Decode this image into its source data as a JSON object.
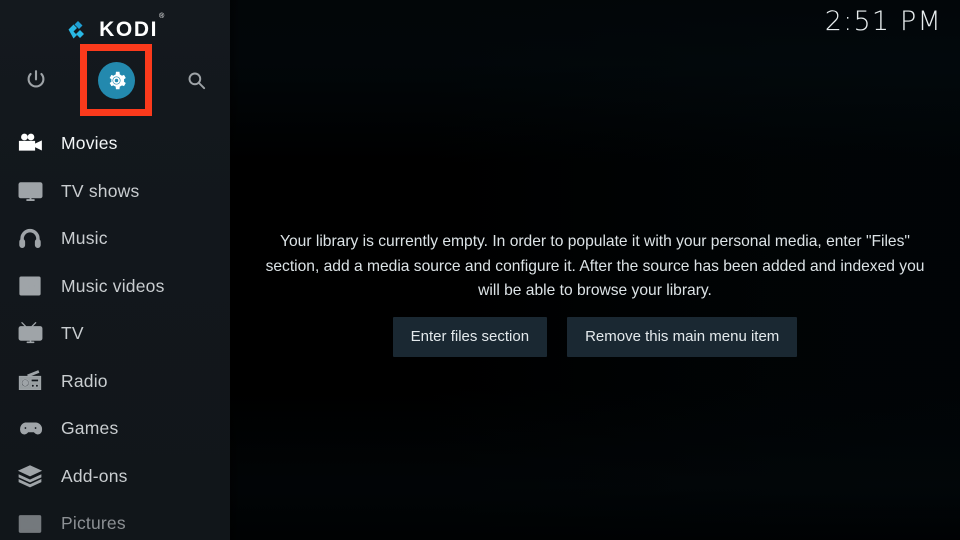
{
  "app": {
    "name": "Kodi",
    "logo_wordmark": "KODI",
    "logo_trademark": "®"
  },
  "colors": {
    "accent_blue": "#29b8e5",
    "gear_circle": "#2389ae",
    "annotation_red": "#fb3a1c",
    "sidebar_bg": "#12171c",
    "background_teal": "#0d3e4e",
    "button_bg": "#1a2832"
  },
  "topbar": {
    "clock": "2:51 PM",
    "icons": [
      {
        "name": "power-icon",
        "label": "Power"
      },
      {
        "name": "settings-gear-icon",
        "label": "Settings",
        "highlighted": true
      },
      {
        "name": "search-icon",
        "label": "Search"
      }
    ]
  },
  "annotation": {
    "type": "highlight-box",
    "target": "settings-gear-icon",
    "color": "#fb3a1c"
  },
  "sidebar": {
    "items": [
      {
        "label": "Movies",
        "icon": "movie-camera-icon",
        "state": "active"
      },
      {
        "label": "TV shows",
        "icon": "tv-monitor-icon",
        "state": "normal"
      },
      {
        "label": "Music",
        "icon": "headphones-icon",
        "state": "normal"
      },
      {
        "label": "Music videos",
        "icon": "music-video-icon",
        "state": "normal"
      },
      {
        "label": "TV",
        "icon": "retro-tv-icon",
        "state": "normal"
      },
      {
        "label": "Radio",
        "icon": "radio-icon",
        "state": "normal"
      },
      {
        "label": "Games",
        "icon": "gamepad-icon",
        "state": "normal"
      },
      {
        "label": "Add-ons",
        "icon": "open-box-icon",
        "state": "normal"
      },
      {
        "label": "Pictures",
        "icon": "picture-frame-icon",
        "state": "dim"
      }
    ]
  },
  "main": {
    "empty_message": "Your library is currently empty. In order to populate it with your personal media, enter \"Files\" section, add a media source and configure it. After the source has been added and indexed you will be able to browse your library.",
    "buttons": [
      {
        "label": "Enter files section"
      },
      {
        "label": "Remove this main menu item"
      }
    ]
  }
}
